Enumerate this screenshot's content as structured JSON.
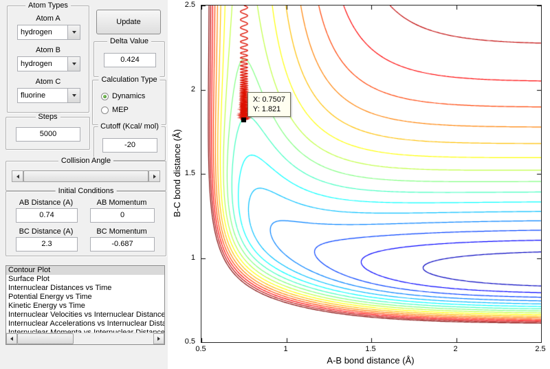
{
  "atom_types": {
    "title": "Atom Types",
    "fields": [
      {
        "label": "Atom A",
        "value": "hydrogen"
      },
      {
        "label": "Atom B",
        "value": "hydrogen"
      },
      {
        "label": "Atom C",
        "value": "fluorine"
      }
    ]
  },
  "update_button_label": "Update",
  "delta_value": {
    "title": "Delta Value",
    "value": "0.424"
  },
  "calculation_type": {
    "title": "Calculation Type",
    "options": [
      {
        "label": "Dynamics",
        "selected": true
      },
      {
        "label": "MEP",
        "selected": false
      }
    ]
  },
  "steps": {
    "title": "Steps",
    "value": "5000"
  },
  "cutoff": {
    "title": "Cutoff (Kcal/ mol)",
    "value": "-20"
  },
  "collision_angle": {
    "title": "Collision Angle"
  },
  "initial_conditions": {
    "title": "Initial Conditions",
    "fields": [
      {
        "label": "AB Distance (A)",
        "value": "0.74"
      },
      {
        "label": "AB Momentum",
        "value": "0"
      },
      {
        "label": "BC Distance (A)",
        "value": "2.3"
      },
      {
        "label": "BC Momentum",
        "value": "-0.687"
      }
    ]
  },
  "plot_list": {
    "selected_index": 0,
    "items": [
      "Contour Plot",
      "Surface Plot",
      "Internuclear Distances vs Time",
      "Potential Energy vs Time",
      "Kinetic Energy vs Time",
      "Internuclear Velocities vs Internuclear Distance",
      "Internuclear Accelerations vs Internuclear Distance",
      "Internuclear Momenta vs Internuclear Distance"
    ]
  },
  "chart_data": {
    "type": "contour",
    "xlabel": "A-B bond distance (Å)",
    "ylabel": "B-C bond distance (Å)",
    "xlim": [
      0.5,
      2.5
    ],
    "ylim": [
      0.5,
      2.5
    ],
    "xticks": [
      0.5,
      1,
      1.5,
      2,
      2.5
    ],
    "yticks": [
      0.5,
      1,
      1.5,
      2,
      2.5
    ],
    "xtick_labels": [
      "0.5",
      "1",
      "1.5",
      "2",
      "2.5"
    ],
    "ytick_labels": [
      "0.5",
      "1",
      "1.5",
      "2",
      "2.5"
    ],
    "colormap": "jet",
    "grid": false,
    "levels": {
      "min": -1.0,
      "max": -0.04,
      "count": 17
    },
    "surface_model": {
      "D_AB": 0.45,
      "a_AB": 3.5,
      "re_AB": 0.74,
      "D_BC": 1.0,
      "a_BC": 2.2,
      "re_BC": 0.92,
      "K_AC": 76,
      "b_AC": 2.5
    },
    "trajectory": {
      "color": "#dd1100",
      "x_center": 0.7507,
      "amplitude": 0.021,
      "y_top": 2.5,
      "y_bottom": 1.821,
      "base_cycles": 14,
      "cycle_accel": 2.2
    },
    "marker": {
      "x": 0.7507,
      "y": 1.821
    },
    "datatip": {
      "line1": "X: 0.7507",
      "line2": "Y: 1.821"
    }
  }
}
